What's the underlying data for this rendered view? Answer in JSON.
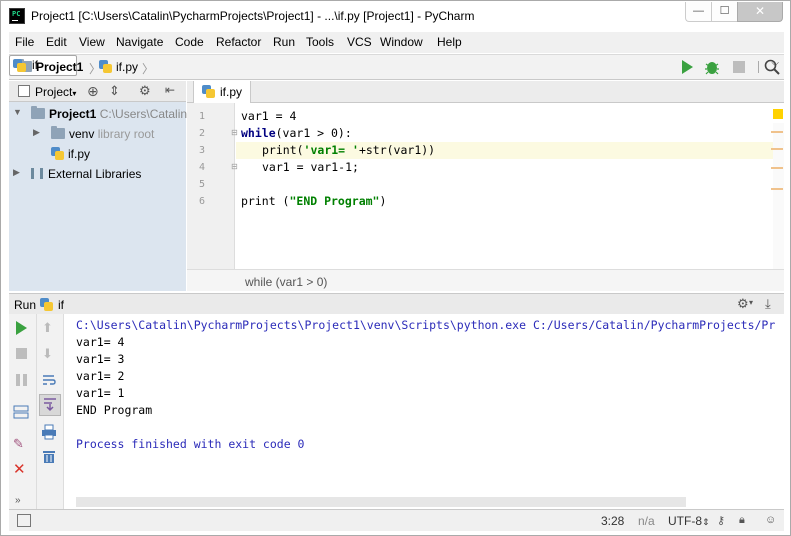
{
  "window": {
    "title": "Project1 [C:\\Users\\Catalin\\PycharmProjects\\Project1] - ...\\if.py [Project1] - PyCharm",
    "min_glyph": "—",
    "max_glyph": "☐",
    "close_glyph": "✕"
  },
  "menu": [
    "File",
    "Edit",
    "View",
    "Navigate",
    "Code",
    "Refactor",
    "Run",
    "Tools",
    "VCS",
    "Window",
    "Help"
  ],
  "breadcrumb": {
    "project": "Project1",
    "file": "if.py"
  },
  "run_config": {
    "name": "if"
  },
  "project_panel": {
    "dropdown_label": "Project",
    "tree": [
      {
        "label": "Project1",
        "detail": "C:\\Users\\Catalin"
      },
      {
        "label": "venv",
        "detail": "library root"
      },
      {
        "label": "if.py",
        "detail": ""
      },
      {
        "label": "External Libraries",
        "detail": ""
      }
    ]
  },
  "editor": {
    "tab_label": "if.py",
    "line_numbers": [
      "1",
      "2",
      "3",
      "4",
      "5",
      "6"
    ],
    "lines": {
      "l1": "var1 = 4",
      "l2_kw": "while",
      "l2_rest": "(var1 > 0):",
      "l3_pre": "print(",
      "l3_str": "'var1= '",
      "l3_post": "+str(var1))",
      "l4": "var1 = var1-1;",
      "l6_pre": "print (",
      "l6_str": "\"END Program\"",
      "l6_post": ")"
    },
    "breadcrumb_status": "while (var1 > 0)"
  },
  "run_panel": {
    "title_prefix": "Run",
    "config_name": "if",
    "console": {
      "command": "C:\\Users\\Catalin\\PycharmProjects\\Project1\\venv\\Scripts\\python.exe C:/Users/Catalin/PycharmProjects/Pr",
      "output": [
        "var1= 4",
        "var1= 3",
        "var1= 2",
        "var1= 1",
        "END Program"
      ],
      "exit": "Process finished with exit code 0"
    }
  },
  "statusbar": {
    "position": "3:28",
    "line_sep": "n/a",
    "encoding": "UTF-8"
  },
  "colors": {
    "accent_run": "#3aa140",
    "console_text": "#2b2bb9",
    "project_selection": "#dce5ef"
  }
}
